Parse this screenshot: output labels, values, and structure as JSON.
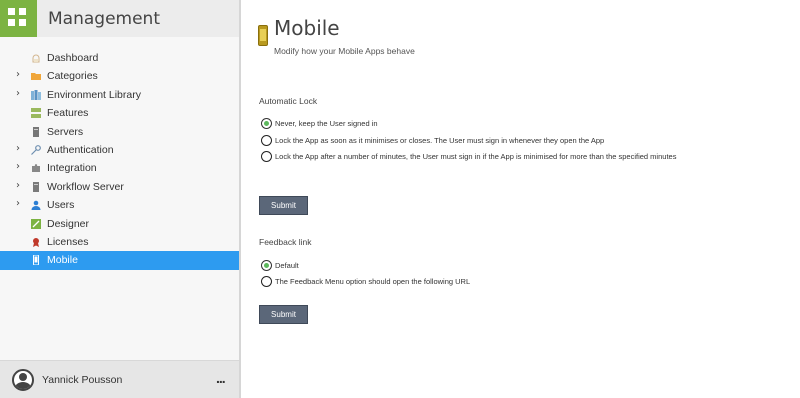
{
  "app": {
    "title": "Management"
  },
  "sidebar": {
    "items": [
      {
        "label": "Dashboard",
        "icon": "dashboard-icon",
        "expandable": false,
        "active": false
      },
      {
        "label": "Categories",
        "icon": "folder-icon",
        "expandable": true,
        "active": false
      },
      {
        "label": "Environment Library",
        "icon": "library-icon",
        "expandable": true,
        "active": false
      },
      {
        "label": "Features",
        "icon": "features-icon",
        "expandable": false,
        "active": false
      },
      {
        "label": "Servers",
        "icon": "server-icon",
        "expandable": false,
        "active": false
      },
      {
        "label": "Authentication",
        "icon": "key-icon",
        "expandable": true,
        "active": false
      },
      {
        "label": "Integration",
        "icon": "puzzle-icon",
        "expandable": true,
        "active": false
      },
      {
        "label": "Workflow Server",
        "icon": "workflow-server-icon",
        "expandable": true,
        "active": false
      },
      {
        "label": "Users",
        "icon": "user-icon",
        "expandable": true,
        "active": false
      },
      {
        "label": "Designer",
        "icon": "designer-icon",
        "expandable": false,
        "active": false
      },
      {
        "label": "Licenses",
        "icon": "license-icon",
        "expandable": false,
        "active": false
      },
      {
        "label": "Mobile",
        "icon": "mobile-icon",
        "expandable": false,
        "active": true
      }
    ],
    "user": {
      "name": "Yannick Pousson",
      "more_label": "..."
    }
  },
  "main": {
    "title": "Mobile",
    "subtitle": "Modify how your Mobile Apps behave",
    "automatic_lock": {
      "label": "Automatic Lock",
      "options": [
        {
          "label": "Never, keep the User signed in",
          "checked": true
        },
        {
          "label": "Lock the App as soon as it minimises or closes. The User must sign in whenever they open the App",
          "checked": false
        },
        {
          "label": "Lock the App after a number of minutes, the User must sign in if the App is minimised for more than the specified minutes",
          "checked": false
        }
      ],
      "submit_label": "Submit"
    },
    "feedback_link": {
      "label": "Feedback link",
      "options": [
        {
          "label": "Default",
          "checked": true
        },
        {
          "label": "The Feedback Menu option should open the following URL",
          "checked": false
        }
      ],
      "submit_label": "Submit"
    }
  },
  "colors": {
    "accent_green": "#7cb342",
    "active_blue": "#2d9bf0",
    "button_slate": "#5b6779",
    "radio_checked": "#5cb85c"
  }
}
